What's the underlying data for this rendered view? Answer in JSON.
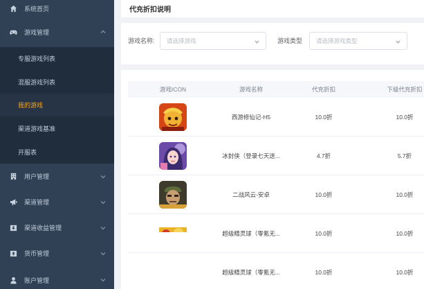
{
  "sidebar": {
    "home": {
      "label": "系统首页",
      "icon": "home-icon"
    },
    "game_mgmt": {
      "label": "游戏管理",
      "icon": "gamepad-icon",
      "items": [
        {
          "label": "专服游戏列表"
        },
        {
          "label": "混服游戏列表"
        },
        {
          "label": "我的游戏",
          "active": true
        },
        {
          "label": "渠道游戏基准"
        },
        {
          "label": "开服表"
        }
      ]
    },
    "menus": [
      {
        "label": "用户管理",
        "icon": "building-icon"
      },
      {
        "label": "渠道管理",
        "icon": "megaphone-icon"
      },
      {
        "label": "渠道收益管理",
        "icon": "download-box-icon"
      },
      {
        "label": "货币管理",
        "icon": "upload-box-icon"
      },
      {
        "label": "账户管理",
        "icon": "user-icon"
      }
    ]
  },
  "page": {
    "title": "代充折扣说明"
  },
  "filters": {
    "game_name": {
      "label": "游戏名称:",
      "placeholder": "请选择游戏"
    },
    "game_type": {
      "label": "游戏类型",
      "placeholder": "请选择游戏类型"
    }
  },
  "table": {
    "columns": [
      "游戏ICON",
      "游戏名称",
      "代充折扣",
      "下级代充折扣"
    ],
    "rows": [
      {
        "name": "西游修仙记-H5",
        "discount": "10.0折",
        "sub_discount": "10.0折",
        "icon": "monkey-king-game-icon"
      },
      {
        "name": "冰封侠（登录七天送...",
        "discount": "4.7折",
        "sub_discount": "5.7折",
        "icon": "anime-girl-game-icon"
      },
      {
        "name": "二战风云-安卓",
        "discount": "10.0折",
        "sub_discount": "10.0折",
        "icon": "soldier-game-icon"
      },
      {
        "name": "超级精灵球（零氪无...",
        "discount": "10.0折",
        "sub_discount": "10.0折",
        "icon": "monster-ball-game-icon"
      },
      {
        "name": "超级精灵球（零氪无...",
        "discount": "10.0折",
        "sub_discount": "10.0折",
        "icon": ""
      }
    ]
  },
  "colors": {
    "sidebar_bg": "#304156",
    "submenu_bg": "#1f2d3d",
    "active_text": "#f5a623"
  }
}
